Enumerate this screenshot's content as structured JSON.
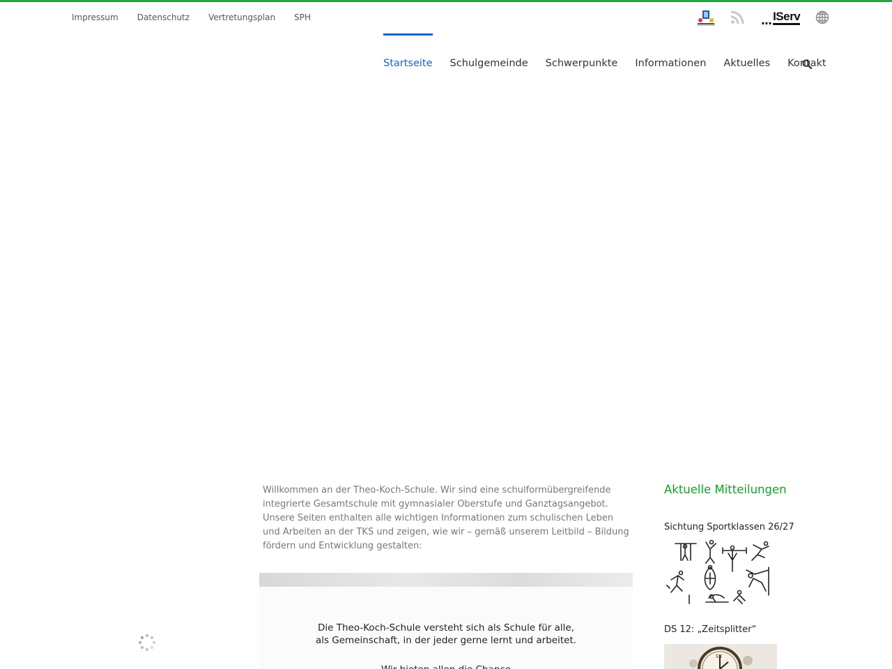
{
  "top_links": [
    "Impressum",
    "Datenschutz",
    "Vertretungsplan",
    "SPH"
  ],
  "top_icons": {
    "iserv_label": "IServ",
    "iserv_dots": "...",
    "icons": [
      "school-app-icon",
      "rss-icon",
      "iserv-logo",
      "globe-icon"
    ]
  },
  "nav": {
    "items": [
      "Startseite",
      "Schulgemeinde",
      "Schwerpunkte",
      "Informationen",
      "Aktuelles",
      "Kontakt"
    ],
    "active": "Startseite"
  },
  "intro": "Willkommen an der Theo-Koch-Schule. Wir sind eine schulformübergreifende integrierte Gesamtschule mit gymnasialer Oberstufe und Ganztagsangebot. Unsere Seiten enthalten alle wichtigen Informationen zum schulischen Leben und Arbeiten an der TKS und zeigen, wie wir – gemäß unserem Leitbild – Bildung fördern und Entwicklung gestalten:",
  "quote": {
    "line1": "Die Theo-Koch-Schule versteht sich als Schule für alle,",
    "line2": "als Gemeinschaft, in der jeder gerne lernt und arbeitet.",
    "line3": "Wir bieten allen die Chance"
  },
  "sidebar": {
    "title": "Aktuelle Mitteilungen",
    "posts": [
      {
        "title": "Sichtung Sportklassen 26/27"
      },
      {
        "title": "DS 12: „Zeitsplitter“"
      }
    ]
  },
  "colors": {
    "accent_green": "#1ea83a",
    "nav_active": "#1764c4",
    "sidebar_title": "#1a9b2e"
  }
}
